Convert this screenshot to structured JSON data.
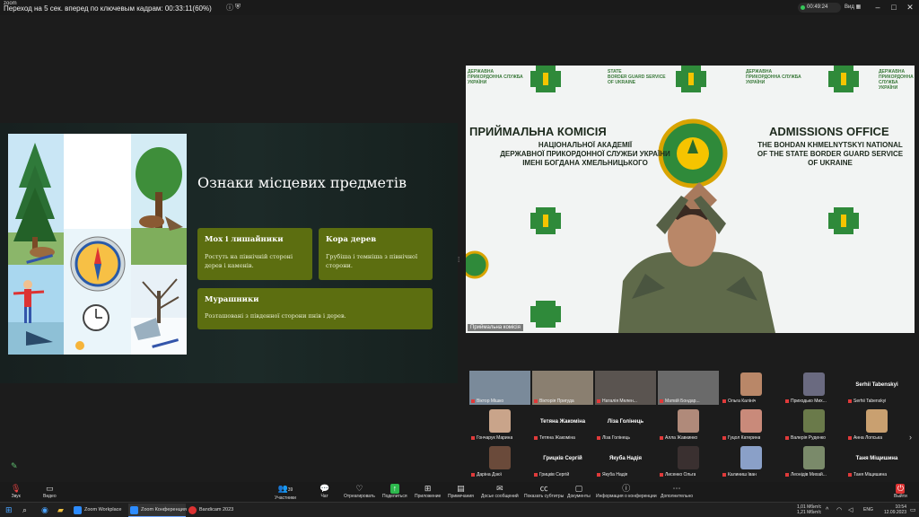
{
  "titlebar": {
    "app_label": "zoom",
    "overlay_text": "Переход на 5 сек. вперед по ключевым кадрам: 00:33:11(60%)",
    "timer": "00:49:24",
    "view_label": "Вид"
  },
  "slide": {
    "title": "Ознаки місцевих предметів",
    "cards": [
      {
        "heading": "Мох і лишайники",
        "text": "Ростуть на північній стороні дерев і каменів."
      },
      {
        "heading": "Кора дерев",
        "text": "Грубіша і темніша з північної сторони."
      },
      {
        "heading": "Мурашники",
        "text": "Розташовані з південної сторони пнів і дерев."
      }
    ]
  },
  "video": {
    "name_tag": "Приймальна комісія",
    "left_heading": "ПРИЙМАЛЬНА КОМІСІЯ",
    "left_sub": [
      "НАЦІОНАЛЬНОЇ АКАДЕМІЇ",
      "ДЕРЖАВНОЇ ПРИКОРДОННОЇ СЛУЖБИ УКРАЇНИ",
      "ІМЕНІ БОГДАНА ХМЕЛЬНИЦЬКОГО"
    ],
    "right_heading": "ADMISSIONS OFFICE",
    "right_sub": [
      "THE BOHDAN KHMELNYTSKYI NATIONAL",
      "OF THE STATE BORDER GUARD SERVICE",
      "OF UKRAINE"
    ],
    "small_ua": [
      "ДЕРЖАВНА",
      "ПРИКОРДОННА СЛУЖБА",
      "УКРАЇНИ"
    ],
    "small_en": [
      "STATE",
      "BORDER GUARD SERVICE",
      "OF UKRAINE"
    ],
    "small_left": [
      "ДЕРЖАВНА",
      "ПРИКОРДОННА СЛУЖБА",
      "УКРАЇНИ"
    ],
    "small_right": [
      "ДЕРЖАВНА",
      "ПРИКОРДОННА СЛУЖБА",
      "УКРАЇНИ"
    ]
  },
  "gallery": {
    "row1": [
      {
        "name": "Віктор Мішко",
        "type": "video"
      },
      {
        "name": "Вікторія Пригуда",
        "type": "video"
      },
      {
        "name": "Наталія Мелен...",
        "type": "video"
      },
      {
        "name": "Матвій Бондар...",
        "type": "video"
      },
      {
        "name": "Ольга Калініч",
        "type": "avatar"
      },
      {
        "name": "Приходько Мих...",
        "type": "avatar"
      },
      {
        "name": "Serhii Tabenskyi",
        "type": "name",
        "big": "Serhii Tabenskyi"
      }
    ],
    "row2": [
      {
        "name": "Гончарук Марина",
        "type": "avatar"
      },
      {
        "name": "Тетяна Жакоміна",
        "type": "name",
        "big": "Тетяна Жакоміна"
      },
      {
        "name": "Ліза Голінець",
        "type": "name",
        "big": "Ліза Голінець"
      },
      {
        "name": "Алла Жавкинко",
        "type": "avatar"
      },
      {
        "name": "Гуцол Катерина",
        "type": "avatar"
      },
      {
        "name": "Валерія Руденко",
        "type": "avatar"
      },
      {
        "name": "Анна Лопська",
        "type": "avatar"
      }
    ],
    "row3": [
      {
        "name": "Даріна Дзюї",
        "type": "avatar"
      },
      {
        "name": "Грицків Сергій",
        "type": "name",
        "big": "Грицків Сергій"
      },
      {
        "name": "Якуба Надія",
        "type": "name",
        "big": "Якуба Надія"
      },
      {
        "name": "Лисенко Ольга",
        "type": "avatar"
      },
      {
        "name": "Калиниш Іван",
        "type": "placeholder"
      },
      {
        "name": "Леонідів Михай...",
        "type": "avatar"
      },
      {
        "name": "Таня Міщишина",
        "type": "name",
        "big": "Таня Міщишина"
      }
    ]
  },
  "toolbar": {
    "audio": "Звук",
    "video": "Видео",
    "participants": "Участники",
    "participants_count": "39",
    "chat": "Чат",
    "react": "Отреагировать",
    "share": "Поделиться",
    "apps": "Приложение",
    "notes": "Примечания",
    "docs": "Досье сообщений",
    "captions": "Показать субтитры",
    "documents": "Документы",
    "info": "Информация о конференции",
    "more": "Дополнительно",
    "leave": "Выйти"
  },
  "taskbar": {
    "apps": [
      "Zoom Workplace",
      "Zoom Конференция",
      "Bandicam 2023"
    ],
    "net_up": "1,01 Мбит/с",
    "net_down": "1,21 Мбит/с",
    "lang": "ENG",
    "time": "10:54",
    "date": "12.09.2023"
  },
  "colors": {
    "card": "#5c6e10",
    "share_green": "#2db84d",
    "leave_red": "#dd3333",
    "slide_bg": "#1c2a28"
  }
}
